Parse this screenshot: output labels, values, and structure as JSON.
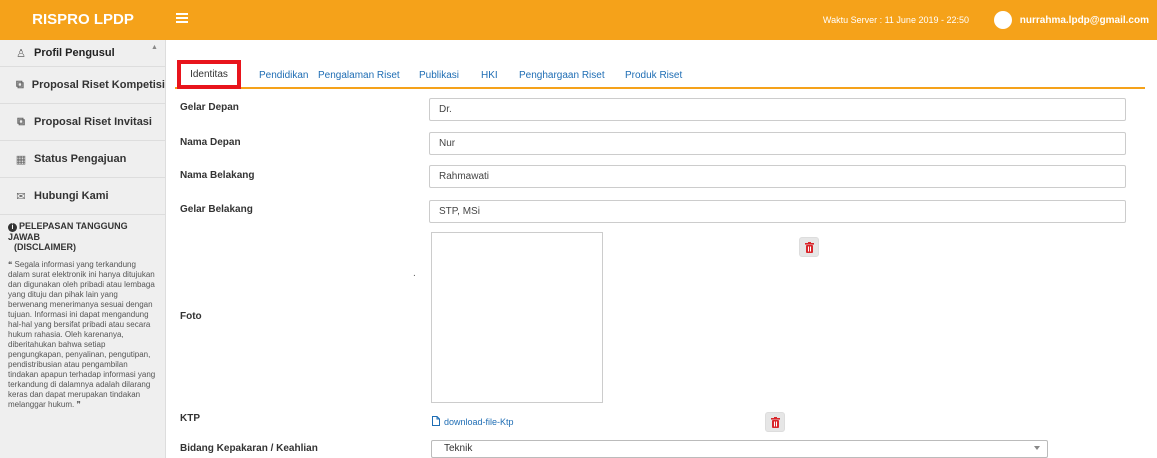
{
  "app": {
    "brand": "RISPRO LPDP"
  },
  "header": {
    "server_time": "Waktu Server : 11 June 2019 - 22:50",
    "user_email": "nurrahma.lpdp@gmail.com"
  },
  "sidebar": {
    "items": [
      {
        "label": "Profil Pengusul",
        "icon": "users-icon"
      },
      {
        "label": "Proposal Riset Kompetisi",
        "icon": "document-icon"
      },
      {
        "label": "Proposal Riset Invitasi",
        "icon": "document-icon"
      },
      {
        "label": "Status Pengajuan",
        "icon": "grid-icon"
      },
      {
        "label": "Hubungi Kami",
        "icon": "envelope-icon"
      }
    ],
    "disclaimer": {
      "title": "PELEPASAN TANGGUNG JAWAB",
      "subtitle": "(DISCLAIMER)",
      "text": "Segala informasi yang terkandung dalam surat elektronik ini hanya ditujukan dan digunakan oleh pribadi atau lembaga yang dituju dan pihak lain yang berwenang menerimanya sesuai dengan tujuan. Informasi ini dapat mengandung hal-hal yang bersifat pribadi atau secara hukum rahasia. Oleh karenanya, diberitahukan bahwa setiap pengungkapan, penyalinan, pengutipan, pendistribusian atau pengambilan tindakan apapun terhadap informasi yang terkandung di dalamnya adalah dilarang keras dan dapat merupakan tindakan melanggar hukum."
    }
  },
  "tabs": [
    "Identitas",
    "Pendidikan",
    "Pengalaman Riset",
    "Publikasi",
    "HKI",
    "Penghargaan Riset",
    "Produk Riset"
  ],
  "form": {
    "gelar_depan": {
      "label": "Gelar Depan",
      "value": "Dr."
    },
    "nama_depan": {
      "label": "Nama Depan",
      "value": "Nur"
    },
    "nama_belakang": {
      "label": "Nama Belakang",
      "value": "Rahmawati"
    },
    "gelar_belakang": {
      "label": "Gelar Belakang",
      "value": "STP, MSi"
    },
    "foto": {
      "label": "Foto",
      "marker": "."
    },
    "ktp": {
      "label": "KTP",
      "link": "download-file-Ktp"
    },
    "bidang": {
      "label": "Bidang Kepakaran / Keahlian",
      "value": "Teknik"
    }
  },
  "colors": {
    "accent": "#f5a21a",
    "highlight": "#e8141c",
    "link": "#1e6db4",
    "delete": "#d9262b"
  }
}
